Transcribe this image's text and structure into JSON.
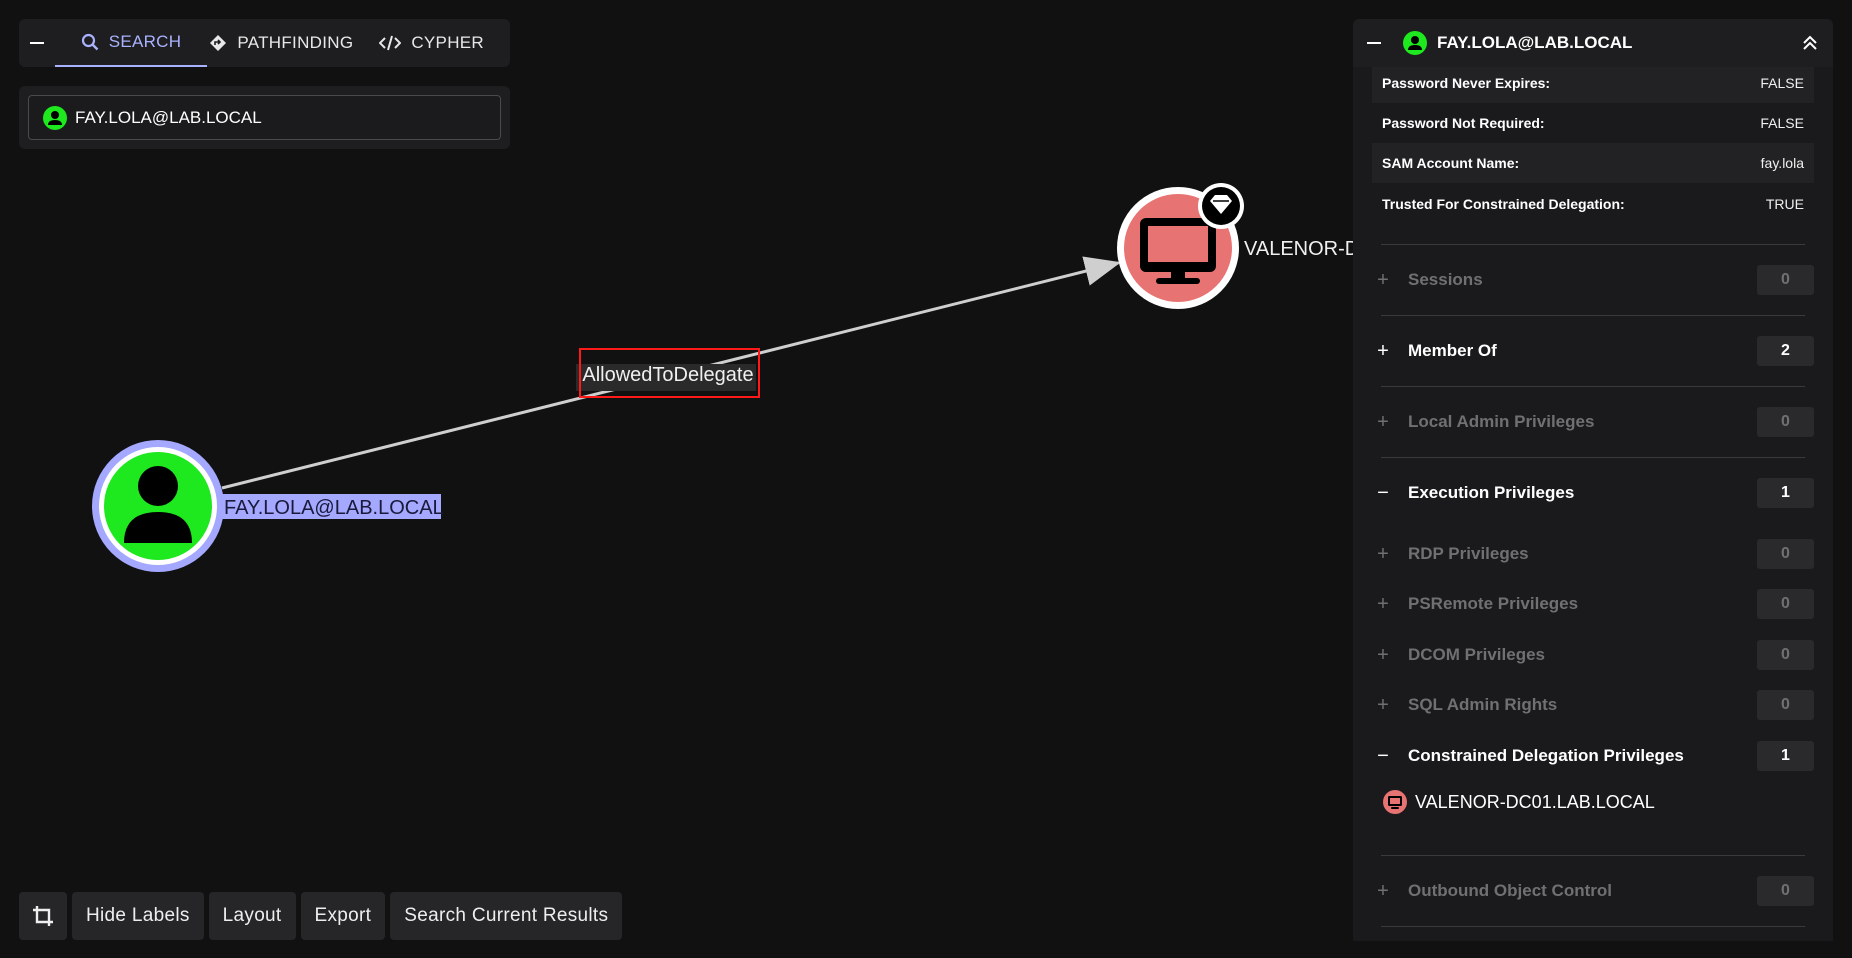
{
  "tabs": [
    {
      "label": "SEARCH"
    },
    {
      "label": "PATHFINDING"
    },
    {
      "label": "CYPHER"
    }
  ],
  "search": {
    "value": "FAY.LOLA@LAB.LOCAL"
  },
  "graph": {
    "source_node": "FAY.LOLA@LAB.LOCAL",
    "target_node": "VALENOR-DC",
    "edge_label": "AllowedToDelegate",
    "colors": {
      "user_node": "#1ee81e",
      "computer_node": "#e87373",
      "edge": "#cfcfcf",
      "selected_label_bg": "#a4a8ff",
      "edge_highlight": "#ff1a1a"
    }
  },
  "toolbar": {
    "hide_labels": "Hide Labels",
    "layout": "Layout",
    "export": "Export",
    "search_current": "Search Current Results"
  },
  "panel": {
    "title": "FAY.LOLA@LAB.LOCAL",
    "properties": [
      {
        "key": "Password Never Expires:",
        "value": "FALSE"
      },
      {
        "key": "Password Not Required:",
        "value": "FALSE"
      },
      {
        "key": "SAM Account Name:",
        "value": "fay.lola"
      },
      {
        "key": "Trusted For Constrained Delegation:",
        "value": "TRUE"
      }
    ],
    "sections": [
      {
        "sign": "+",
        "label": "Sessions",
        "count": "0"
      },
      {
        "sign": "+",
        "label": "Member Of",
        "count": "2"
      },
      {
        "sign": "+",
        "label": "Local Admin Privileges",
        "count": "0"
      },
      {
        "sign": "−",
        "label": "Execution Privileges",
        "count": "1"
      },
      {
        "sign": "+",
        "label": "RDP Privileges",
        "count": "0"
      },
      {
        "sign": "+",
        "label": "PSRemote Privileges",
        "count": "0"
      },
      {
        "sign": "+",
        "label": "DCOM Privileges",
        "count": "0"
      },
      {
        "sign": "+",
        "label": "SQL Admin Rights",
        "count": "0"
      },
      {
        "sign": "−",
        "label": "Constrained Delegation Privileges",
        "count": "1"
      },
      {
        "sign": "+",
        "label": "Outbound Object Control",
        "count": "0"
      }
    ],
    "delegation_target": "VALENOR-DC01.LAB.LOCAL"
  }
}
